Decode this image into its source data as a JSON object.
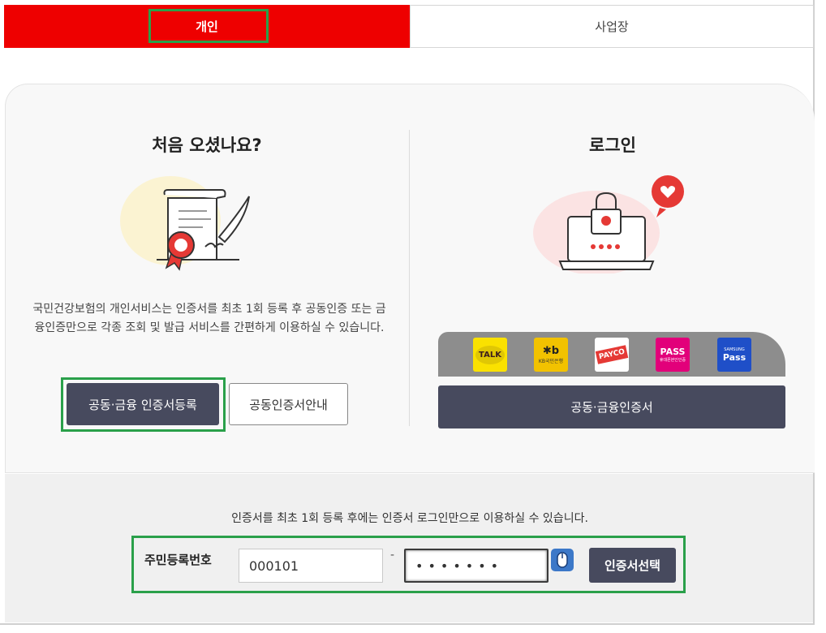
{
  "tabs": {
    "personal": "개인",
    "business": "사업장"
  },
  "first_visit": {
    "heading": "처음 오셨나요?",
    "description": "국민건강보험의 개인서비스는 인증서를 최초 1회 등록 후 공동인증 또는 금융인증만으로 각종 조회 및 발급 서비스를 간편하게 이용하실 수 있습니다.",
    "register_button": "공동·금융 인증서등록",
    "guide_button": "공동인증서안내"
  },
  "login": {
    "heading": "로그인",
    "providers": [
      {
        "label": "TALK",
        "icon": "kakao-talk-icon"
      },
      {
        "label": "KB국민은행",
        "icon": "kb-bank-icon"
      },
      {
        "label": "PAYCO",
        "icon": "payco-icon"
      },
      {
        "label": "PASS",
        "sub": "휴대폰본인인증",
        "icon": "pass-icon"
      },
      {
        "label": "Pass",
        "sub": "SAMSUNG",
        "icon": "samsung-pass-icon"
      }
    ],
    "cert_button": "공동·금융인증서"
  },
  "bottom": {
    "note": "인증서를 최초 1회 등록 후에는 인증서 로그인만으로 이용하실 수 있습니다.",
    "rrn_label": "주민등록번호",
    "rrn_front": "000101",
    "rrn_separator": "-",
    "rrn_back_masked": "•••••••",
    "select_cert_button": "인증서선택"
  },
  "colors": {
    "accent_red": "#ee0000",
    "button_dark": "#474a5e",
    "highlight_green": "#2aa04a"
  }
}
